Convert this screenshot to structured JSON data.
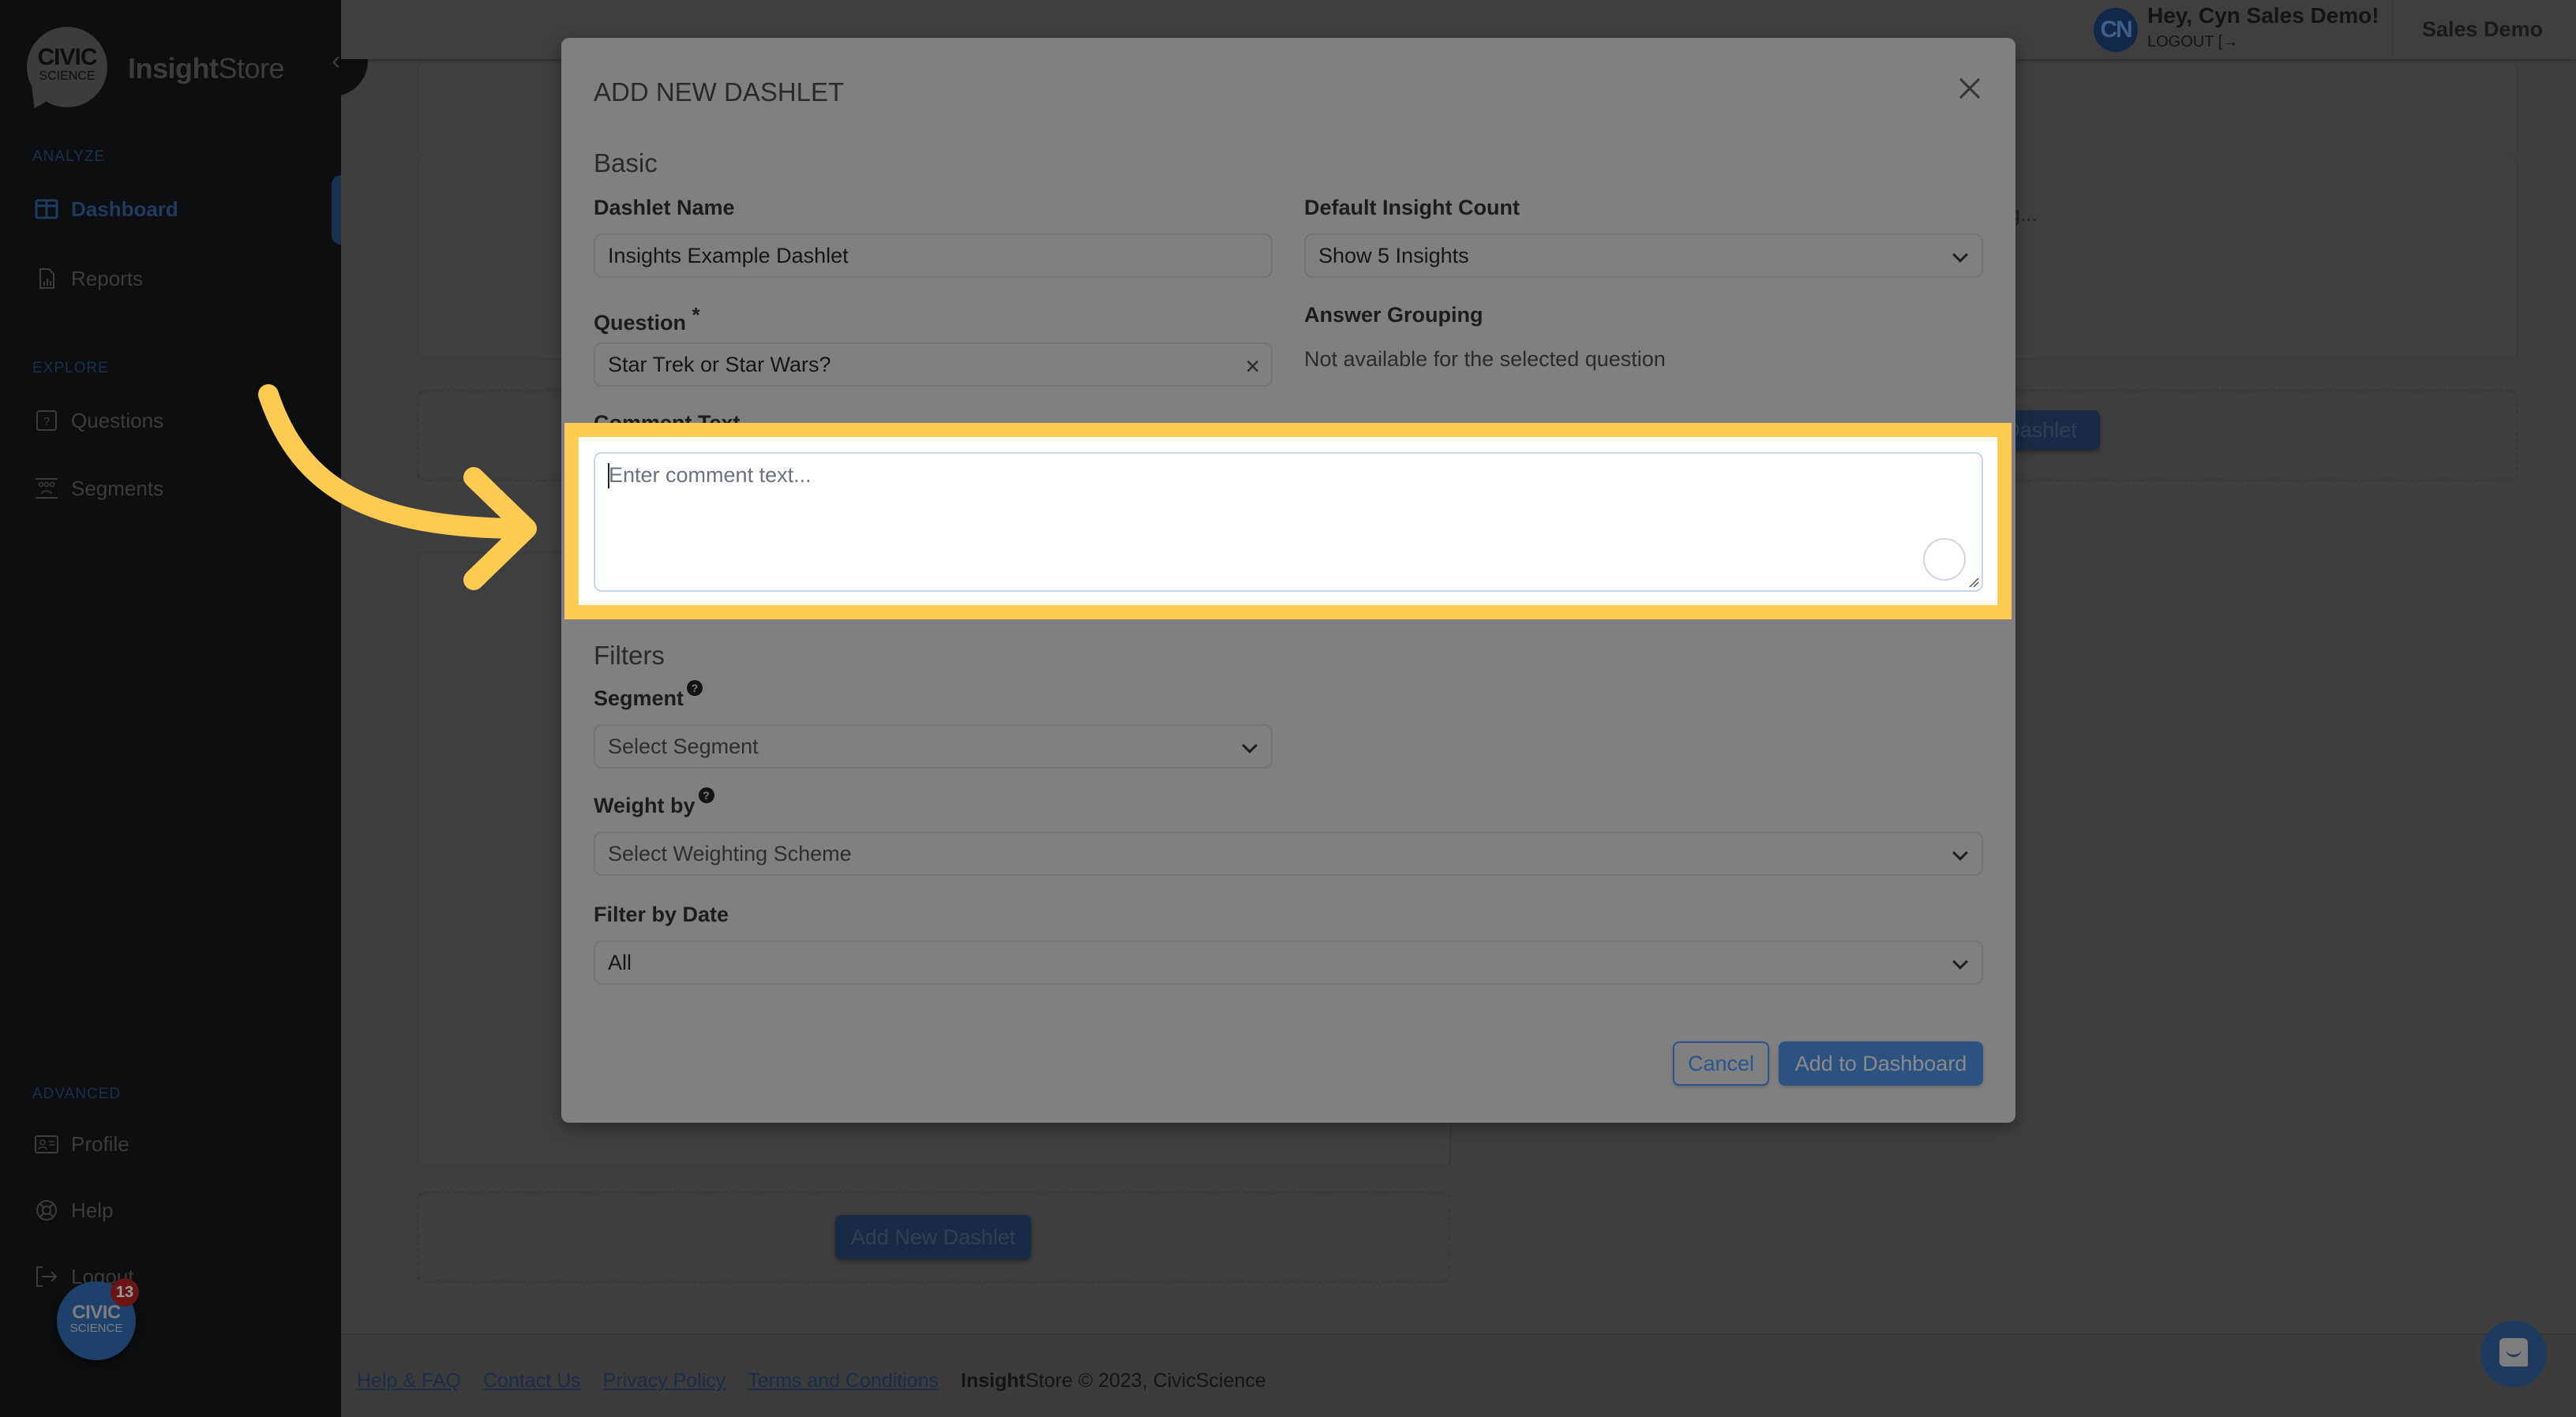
{
  "sidebar": {
    "logo": {
      "line1": "CIVIC",
      "line2": "SCIENCE"
    },
    "brand": {
      "bold": "Insight",
      "regular": "Store"
    },
    "collapse_icon": "chevron-left-icon",
    "sections": [
      {
        "label": "ANALYZE",
        "items": [
          {
            "label": "Dashboard",
            "icon": "dashboard-icon",
            "active": true
          },
          {
            "label": "Reports",
            "icon": "report-icon",
            "active": false
          }
        ]
      },
      {
        "label": "EXPLORE",
        "items": [
          {
            "label": "Questions",
            "icon": "question-icon",
            "active": false
          },
          {
            "label": "Segments",
            "icon": "segments-icon",
            "active": false
          }
        ]
      },
      {
        "label": "ADVANCED",
        "items": [
          {
            "label": "Profile",
            "icon": "profile-card-icon",
            "active": false
          },
          {
            "label": "Help",
            "icon": "lifebuoy-icon",
            "active": false
          },
          {
            "label": "Logout",
            "icon": "logout-icon",
            "active": false
          }
        ]
      }
    ],
    "fab": {
      "line1": "CIVIC",
      "line2": "SCIENCE",
      "badge": "13"
    }
  },
  "header": {
    "avatar_initials": "CN",
    "greeting": "Hey, Cyn Sales Demo!",
    "logout_label": "LOGOUT",
    "org_name": "Sales Demo"
  },
  "background": {
    "loading_text": "ng...",
    "add_dashlet_partial": "Dashlet",
    "add_dashlet_button": "Add New Dashlet"
  },
  "footer": {
    "links": [
      "Help & FAQ",
      "Contact Us",
      "Privacy Policy",
      "Terms and Conditions"
    ],
    "copyright_bold": "Insight",
    "copyright_rest": "Store © 2023, CivicScience"
  },
  "modal": {
    "title": "ADD NEW DASHLET",
    "basic_heading": "Basic",
    "dashlet_name": {
      "label": "Dashlet Name",
      "value": "Insights Example Dashlet"
    },
    "insight_count": {
      "label": "Default Insight Count",
      "value": "Show 5 Insights"
    },
    "question": {
      "label": "Question",
      "required_mark": "*",
      "value": "Star Trek or Star Wars?"
    },
    "answer_grouping": {
      "label": "Answer Grouping",
      "value": "Not available for the selected question"
    },
    "comment": {
      "label": "Comment Text",
      "placeholder": "Enter comment text...",
      "value": ""
    },
    "filters_heading": "Filters",
    "segment": {
      "label": "Segment",
      "help": "?",
      "placeholder": "Select Segment"
    },
    "weight_by": {
      "label": "Weight by",
      "help": "?",
      "placeholder": "Select Weighting Scheme"
    },
    "filter_date": {
      "label": "Filter by Date",
      "value": "All"
    },
    "cancel_label": "Cancel",
    "submit_label": "Add to Dashboard"
  },
  "annotation": {
    "highlight_color": "#fecb52",
    "target": "comment-text-area"
  },
  "colors": {
    "brand_blue": "#2c5281",
    "sidebar_bg": "#0d0e10",
    "overlay_bg": "#3e3e3e"
  }
}
